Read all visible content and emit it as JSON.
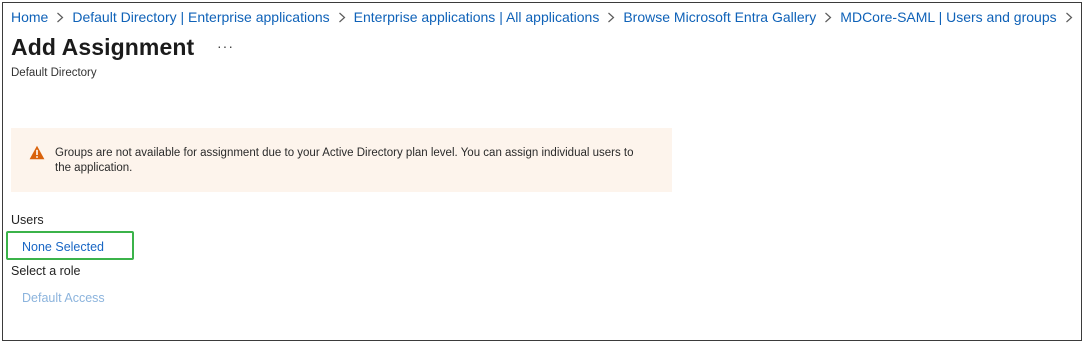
{
  "breadcrumb": {
    "items": [
      "Home",
      "Default Directory | Enterprise applications",
      "Enterprise applications | All applications",
      "Browse Microsoft Entra Gallery",
      "MDCore-SAML | Users and groups"
    ]
  },
  "header": {
    "title": "Add Assignment",
    "more_label": "···",
    "subtitle": "Default Directory"
  },
  "warning": {
    "icon": "warning-triangle-icon",
    "color": "#d9620b",
    "text": "Groups are not available for assignment due to your Active Directory plan level. You can assign individual users to the application."
  },
  "users": {
    "label": "Users",
    "value": "None Selected"
  },
  "role": {
    "label": "Select a role",
    "value": "Default Access"
  },
  "colors": {
    "link": "#0f62b8",
    "highlight_border": "#3bb34a",
    "warning_bg": "#fdf4ec",
    "disabled_link": "#8cb4dd"
  }
}
